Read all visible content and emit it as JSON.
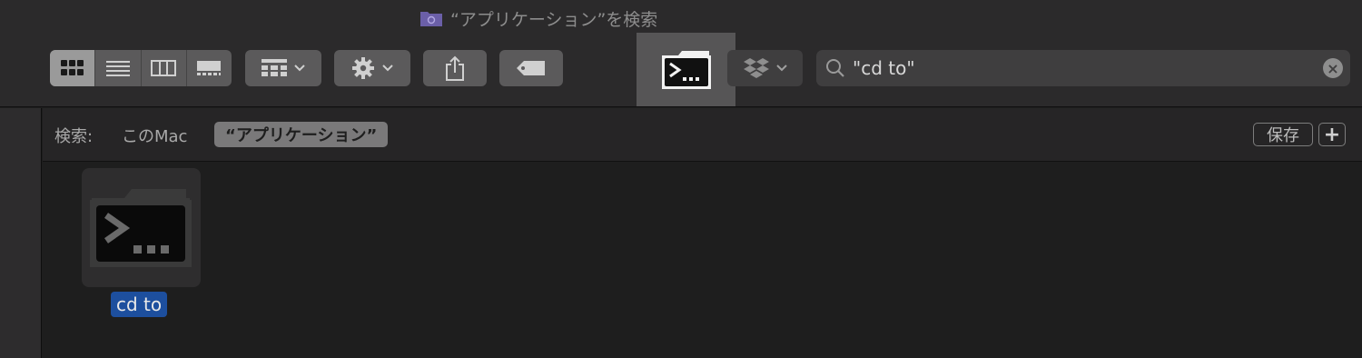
{
  "window": {
    "title": "“アプリケーション”を検索"
  },
  "toolbar": {
    "view_modes": [
      "icon-view",
      "list-view",
      "column-view",
      "gallery-view"
    ],
    "group_button": "group-by",
    "action_button": "action-menu",
    "share_button": "share",
    "tag_button": "tags",
    "dropbox_button": "dropbox"
  },
  "search": {
    "value": "\"cd to\""
  },
  "scope": {
    "label": "検索:",
    "this_mac": "このMac",
    "applications": "“アプリケーション”",
    "save": "保存",
    "add": "+"
  },
  "results": [
    {
      "name": "cd to"
    }
  ],
  "colors": {
    "selection": "#1d4f9e",
    "background": "#1e1e1e",
    "toolbar": "#2b2a2b"
  }
}
